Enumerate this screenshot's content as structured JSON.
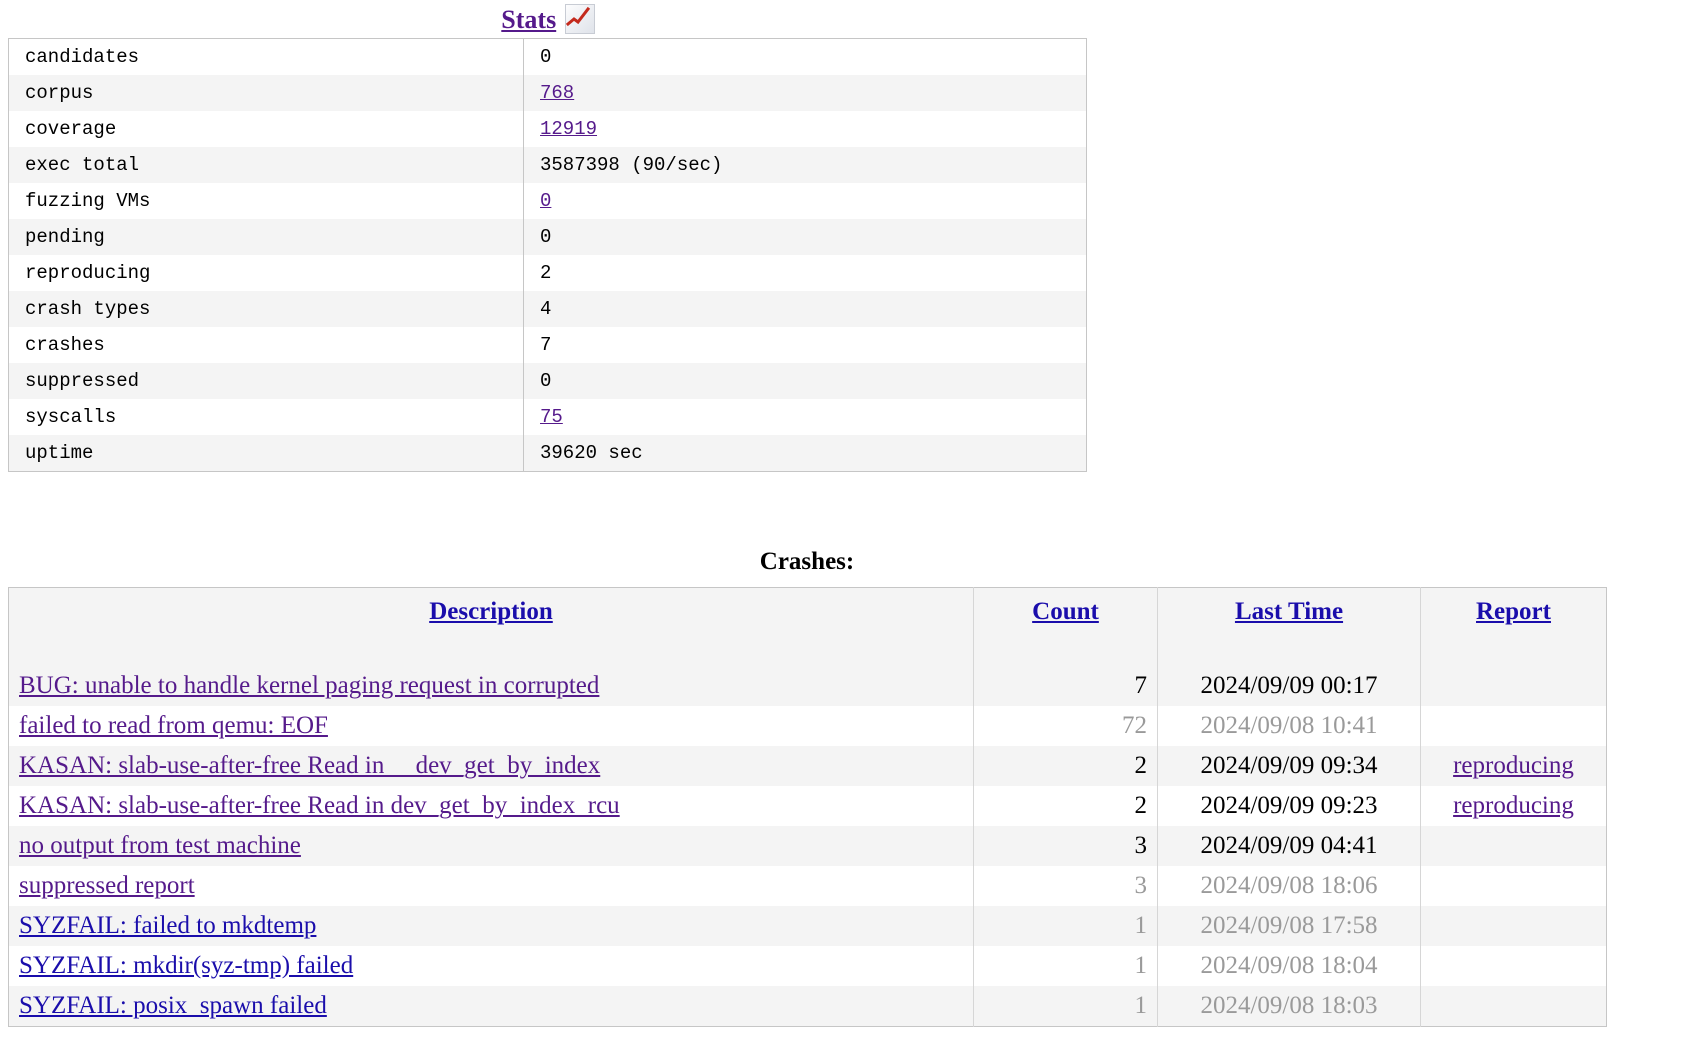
{
  "stats": {
    "heading": "Stats",
    "chart_icon": "line-chart-icon",
    "rows": [
      {
        "key": "candidates",
        "value": "0",
        "link": false
      },
      {
        "key": "corpus",
        "value": "768",
        "link": true
      },
      {
        "key": "coverage",
        "value": "12919",
        "link": true
      },
      {
        "key": "exec total",
        "value": "3587398 (90/sec)",
        "link": false
      },
      {
        "key": "fuzzing VMs",
        "value": "0",
        "link": true
      },
      {
        "key": "pending",
        "value": "0",
        "link": false
      },
      {
        "key": "reproducing",
        "value": "2",
        "link": false
      },
      {
        "key": "crash types",
        "value": "4",
        "link": false
      },
      {
        "key": "crashes",
        "value": "7",
        "link": false
      },
      {
        "key": "suppressed",
        "value": "0",
        "link": false
      },
      {
        "key": "syscalls",
        "value": "75",
        "link": true
      },
      {
        "key": "uptime",
        "value": "39620 sec",
        "link": false
      }
    ]
  },
  "crashes": {
    "heading": "Crashes:",
    "columns": [
      "Description",
      "Count",
      "Last Time",
      "Report"
    ],
    "rows": [
      {
        "description": "BUG: unable to handle kernel paging request in corrupted",
        "desc_state": "visited",
        "count": "7",
        "last_time": "2024/09/09 00:17",
        "muted": false,
        "report": ""
      },
      {
        "description": "failed to read from qemu: EOF",
        "desc_state": "visited",
        "count": "72",
        "last_time": "2024/09/08 10:41",
        "muted": true,
        "report": ""
      },
      {
        "description": "KASAN: slab-use-after-free Read in __dev_get_by_index",
        "desc_state": "visited",
        "count": "2",
        "last_time": "2024/09/09 09:34",
        "muted": false,
        "report": "reproducing"
      },
      {
        "description": "KASAN: slab-use-after-free Read in dev_get_by_index_rcu",
        "desc_state": "visited",
        "count": "2",
        "last_time": "2024/09/09 09:23",
        "muted": false,
        "report": "reproducing"
      },
      {
        "description": "no output from test machine",
        "desc_state": "visited",
        "count": "3",
        "last_time": "2024/09/09 04:41",
        "muted": false,
        "report": ""
      },
      {
        "description": "suppressed report",
        "desc_state": "visited",
        "count": "3",
        "last_time": "2024/09/08 18:06",
        "muted": true,
        "report": ""
      },
      {
        "description": "SYZFAIL: failed to mkdtemp",
        "desc_state": "new",
        "count": "1",
        "last_time": "2024/09/08 17:58",
        "muted": true,
        "report": ""
      },
      {
        "description": "SYZFAIL: mkdir(syz-tmp) failed",
        "desc_state": "new",
        "count": "1",
        "last_time": "2024/09/08 18:04",
        "muted": true,
        "report": ""
      },
      {
        "description": "SYZFAIL: posix_spawn failed",
        "desc_state": "new",
        "count": "1",
        "last_time": "2024/09/08 18:03",
        "muted": true,
        "report": ""
      }
    ]
  },
  "colors": {
    "link_new": "#1a0dab",
    "link_visited": "#551a8b",
    "muted_text": "#9a9a9a",
    "row_alt_bg": "#f4f4f4",
    "border": "#c6c6c6",
    "chart_line": "#c42a1c"
  }
}
